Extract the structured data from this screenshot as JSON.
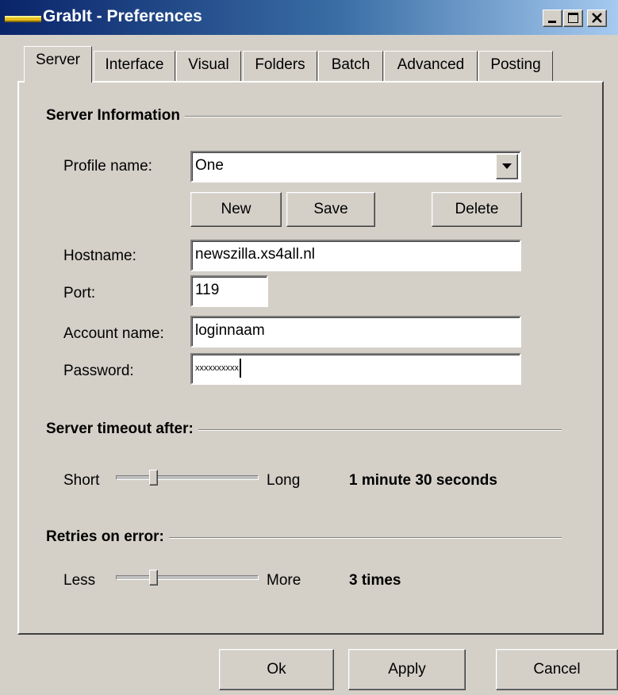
{
  "window": {
    "title": "GrabIt - Preferences",
    "title_bar_color": "#0a246a",
    "controls": [
      "minimize-icon",
      "maximize-icon",
      "close-icon"
    ]
  },
  "tabs": [
    {
      "label": "Server",
      "active": true
    },
    {
      "label": "Interface",
      "active": false
    },
    {
      "label": "Visual",
      "active": false
    },
    {
      "label": "Folders",
      "active": false
    },
    {
      "label": "Batch",
      "active": false
    },
    {
      "label": "Advanced",
      "active": false
    },
    {
      "label": "Posting",
      "active": false
    }
  ],
  "server_info": {
    "heading": "Server Information",
    "profile_label": "Profile name:",
    "profile_value": "One",
    "new_label": "New",
    "save_label": "Save",
    "delete_label": "Delete",
    "hostname_label": "Hostname:",
    "hostname_value": "newszilla.xs4all.nl",
    "port_label": "Port:",
    "port_value": "119",
    "account_label": "Account name:",
    "account_value": "loginnaam",
    "password_label": "Password:",
    "password_value": "xxxxxxxxxx"
  },
  "timeout": {
    "heading": "Server timeout after:",
    "min_label": "Short",
    "max_label": "Long",
    "value_text": "1 minute 30 seconds",
    "slider_fraction": 0.25
  },
  "retries": {
    "heading": "Retries on error:",
    "min_label": "Less",
    "max_label": "More",
    "value_text": "3 times",
    "slider_fraction": 0.25
  },
  "footer": {
    "ok_label": "Ok",
    "apply_label": "Apply",
    "cancel_label": "Cancel"
  }
}
